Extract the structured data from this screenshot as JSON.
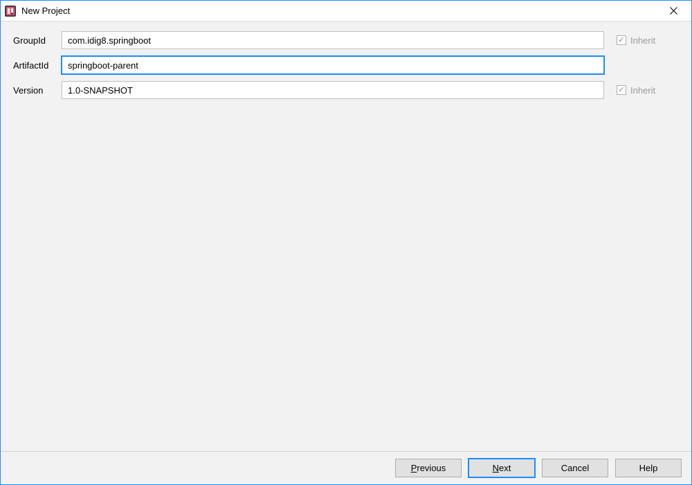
{
  "titlebar": {
    "title": "New Project"
  },
  "form": {
    "groupId": {
      "label": "GroupId",
      "value": "com.idig8.springboot",
      "inherit_label": "Inherit",
      "inherit_checked": true
    },
    "artifactId": {
      "label": "ArtifactId",
      "value": "springboot-parent"
    },
    "version": {
      "label": "Version",
      "value": "1.0-SNAPSHOT",
      "inherit_label": "Inherit",
      "inherit_checked": true
    }
  },
  "buttons": {
    "previous": "Previous",
    "next": "Next",
    "cancel": "Cancel",
    "help": "Help"
  }
}
